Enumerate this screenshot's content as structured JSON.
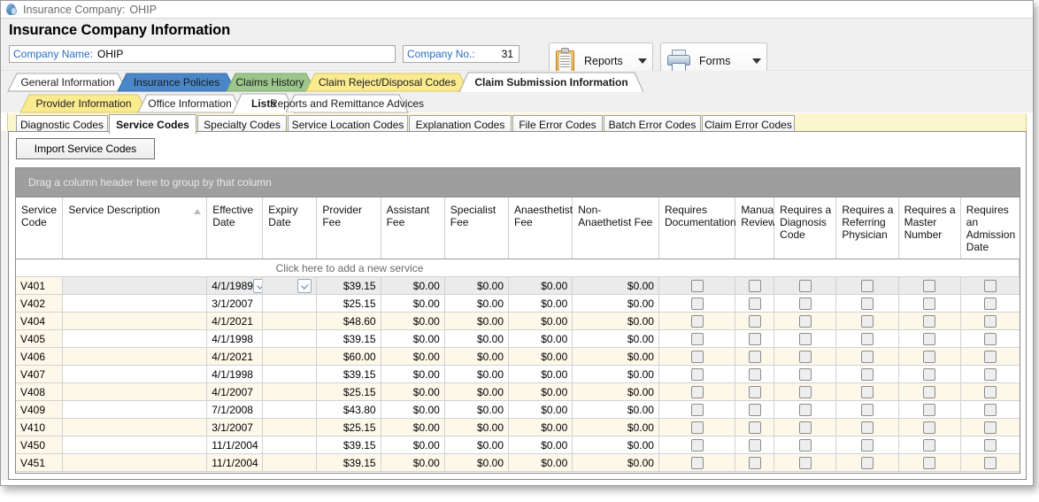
{
  "titlebar": {
    "icon": "company-icon",
    "label": "Insurance Company:",
    "value": "OHIP"
  },
  "header": {
    "page_title": "Insurance Company Information",
    "company_name_label": "Company Name:",
    "company_name_value": "OHIP",
    "company_no_label": "Company No.:",
    "company_no_value": "31",
    "buttons": [
      {
        "label": "Reports",
        "icon": "clipboard-icon"
      },
      {
        "label": "Forms",
        "icon": "printer-icon"
      }
    ]
  },
  "tabs_row1": [
    {
      "label": "General Information",
      "color": "#ffffff",
      "active": false
    },
    {
      "label": "Insurance Policies",
      "color": "#4a87c8",
      "active": false
    },
    {
      "label": "Claims History",
      "color": "#9bc48a",
      "active": false
    },
    {
      "label": "Claim Reject/Disposal Codes",
      "color": "#fbeb8f",
      "active": false
    },
    {
      "label": "Claim Submission Information",
      "color": "#ffffff",
      "active": true
    }
  ],
  "tabs_row2": [
    {
      "label": "Provider Information",
      "color": "#fbeb8f",
      "active": false
    },
    {
      "label": "Office Information",
      "color": "#ffffff",
      "active": false
    },
    {
      "label": "Lists",
      "color": "#ffffff",
      "active": true
    },
    {
      "label": "Reports and Remittance Advices",
      "color": "#ffffff",
      "active": false
    }
  ],
  "tabs_row3": [
    {
      "label": "Diagnostic Codes",
      "active": false
    },
    {
      "label": "Service Codes",
      "active": true
    },
    {
      "label": "Specialty Codes",
      "active": false
    },
    {
      "label": "Service Location Codes",
      "active": false
    },
    {
      "label": "Explanation Codes",
      "active": false
    },
    {
      "label": "File Error Codes",
      "active": false
    },
    {
      "label": "Batch Error Codes",
      "active": false
    },
    {
      "label": "Claim Error Codes",
      "active": false
    }
  ],
  "toolbar": {
    "import_label": "Import Service Codes"
  },
  "grid": {
    "group_panel_text": "Drag a column header here to group by that column",
    "add_row_text": "Click here to add a new service",
    "sorted_column": "Service Description",
    "sort_direction": "ascending",
    "columns": [
      "Service Code",
      "Service Description",
      "Effective Date",
      "Expiry Date",
      "Provider Fee",
      "Assistant Fee",
      "Specialist Fee",
      "Anaesthetist Fee",
      "Non-Anaethetist Fee",
      "Requires Documentation",
      "Manual Review",
      "Requires a Diagnosis Code",
      "Requires a Referring Physician",
      "Requires a Master Number",
      "Requires an Admission Date"
    ],
    "rows": [
      {
        "code": "V401",
        "description": "",
        "effective": "4/1/1989",
        "expiry": "",
        "provider_fee": "$39.15",
        "assistant_fee": "$0.00",
        "specialist_fee": "$0.00",
        "anaesthetist_fee": "$0.00",
        "non_anaesthetist_fee": "$0.00",
        "selected": true
      },
      {
        "code": "V402",
        "description": "",
        "effective": "3/1/2007",
        "expiry": "",
        "provider_fee": "$25.15",
        "assistant_fee": "$0.00",
        "specialist_fee": "$0.00",
        "anaesthetist_fee": "$0.00",
        "non_anaesthetist_fee": "$0.00",
        "selected": false
      },
      {
        "code": "V404",
        "description": "",
        "effective": "4/1/2021",
        "expiry": "",
        "provider_fee": "$48.60",
        "assistant_fee": "$0.00",
        "specialist_fee": "$0.00",
        "anaesthetist_fee": "$0.00",
        "non_anaesthetist_fee": "$0.00",
        "selected": false
      },
      {
        "code": "V405",
        "description": "",
        "effective": "4/1/1998",
        "expiry": "",
        "provider_fee": "$39.15",
        "assistant_fee": "$0.00",
        "specialist_fee": "$0.00",
        "anaesthetist_fee": "$0.00",
        "non_anaesthetist_fee": "$0.00",
        "selected": false
      },
      {
        "code": "V406",
        "description": "",
        "effective": "4/1/2021",
        "expiry": "",
        "provider_fee": "$60.00",
        "assistant_fee": "$0.00",
        "specialist_fee": "$0.00",
        "anaesthetist_fee": "$0.00",
        "non_anaesthetist_fee": "$0.00",
        "selected": false
      },
      {
        "code": "V407",
        "description": "",
        "effective": "4/1/1998",
        "expiry": "",
        "provider_fee": "$39.15",
        "assistant_fee": "$0.00",
        "specialist_fee": "$0.00",
        "anaesthetist_fee": "$0.00",
        "non_anaesthetist_fee": "$0.00",
        "selected": false
      },
      {
        "code": "V408",
        "description": "",
        "effective": "4/1/2007",
        "expiry": "",
        "provider_fee": "$25.15",
        "assistant_fee": "$0.00",
        "specialist_fee": "$0.00",
        "anaesthetist_fee": "$0.00",
        "non_anaesthetist_fee": "$0.00",
        "selected": false
      },
      {
        "code": "V409",
        "description": "",
        "effective": "7/1/2008",
        "expiry": "",
        "provider_fee": "$43.80",
        "assistant_fee": "$0.00",
        "specialist_fee": "$0.00",
        "anaesthetist_fee": "$0.00",
        "non_anaesthetist_fee": "$0.00",
        "selected": false
      },
      {
        "code": "V410",
        "description": "",
        "effective": "3/1/2007",
        "expiry": "",
        "provider_fee": "$25.15",
        "assistant_fee": "$0.00",
        "specialist_fee": "$0.00",
        "anaesthetist_fee": "$0.00",
        "non_anaesthetist_fee": "$0.00",
        "selected": false
      },
      {
        "code": "V450",
        "description": "",
        "effective": "11/1/2004",
        "expiry": "",
        "provider_fee": "$39.15",
        "assistant_fee": "$0.00",
        "specialist_fee": "$0.00",
        "anaesthetist_fee": "$0.00",
        "non_anaesthetist_fee": "$0.00",
        "selected": false
      },
      {
        "code": "V451",
        "description": "",
        "effective": "11/1/2004",
        "expiry": "",
        "provider_fee": "$39.15",
        "assistant_fee": "$0.00",
        "specialist_fee": "$0.00",
        "anaesthetist_fee": "$0.00",
        "non_anaesthetist_fee": "$0.00",
        "selected": false
      }
    ]
  }
}
